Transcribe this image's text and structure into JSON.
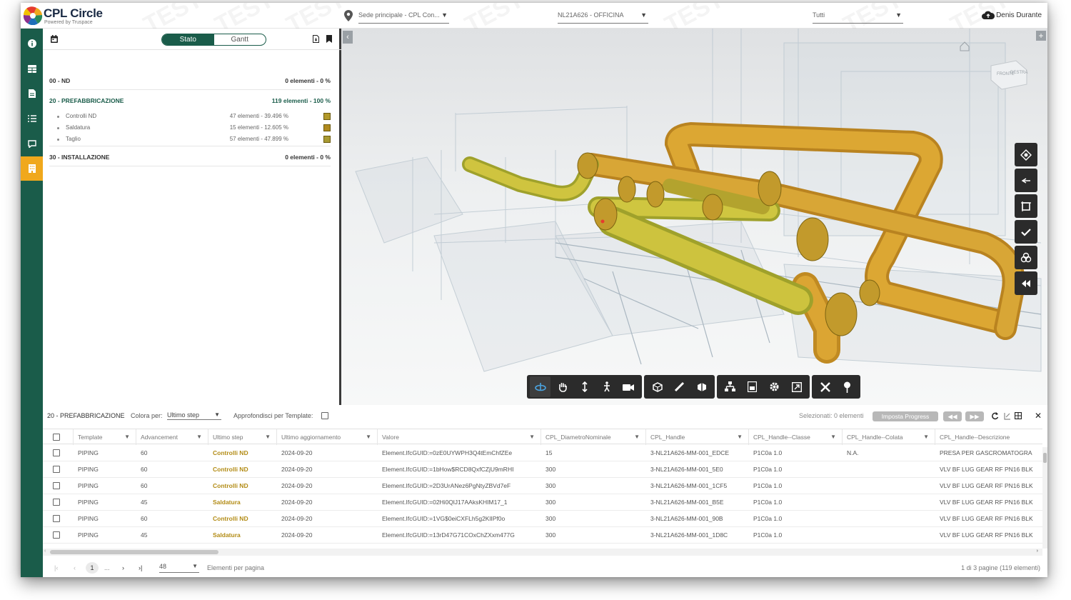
{
  "app": {
    "name": "CPL Circle",
    "tagline": "Powered by Truspace"
  },
  "header": {
    "site": "Sede principale - CPL Con...",
    "project": "NL21A626 - OFFICINA",
    "filter": "Tutti",
    "user": "Denis Durante",
    "watermark": "TEST"
  },
  "sidebar": {
    "items": [
      "info-icon",
      "grid-icon",
      "document-icon",
      "list-icon",
      "comment-icon",
      "building-icon"
    ],
    "active_index": 5
  },
  "left_panel": {
    "toggle": {
      "stato": "Stato",
      "gantt": "Gantt",
      "selected": "Stato"
    },
    "groups": [
      {
        "title": "00 - ND",
        "value": "0 elementi - 0 %"
      },
      {
        "title": "20 - PREFABBRICAZIONE",
        "value": "119 elementi - 100 %"
      },
      {
        "title": "30 - INSTALLAZIONE",
        "value": "0 elementi - 0 %"
      }
    ],
    "sub_items": [
      {
        "label": "Controlli ND",
        "value": "47 elementi - 39.496 %"
      },
      {
        "label": "Saldatura",
        "value": "15 elementi - 12.605 %"
      },
      {
        "label": "Taglio",
        "value": "57 elementi - 47.899 %"
      }
    ]
  },
  "viewer": {
    "view_cube_labels": [
      "FRONTE",
      "DESTRA"
    ]
  },
  "table_bar": {
    "group": "20 - PREFABBRICAZIONE",
    "color_by_label": "Colora per:",
    "color_by_value": "Ultimo step",
    "drill_label": "Approfondisci per Template:",
    "selected": "Selezionati: 0 elementi",
    "set_progress": "Imposta Progress"
  },
  "table": {
    "columns": [
      "Template",
      "Advancement",
      "Ultimo step",
      "Ultimo aggiornamento",
      "Valore",
      "CPL_DiametroNominale",
      "CPL_Handle",
      "CPL_Handle--Classe",
      "CPL_Handle--Colata",
      "CPL_Handle--Descrizione"
    ],
    "rows": [
      [
        "PIPING",
        "60",
        "Controlli ND",
        "2024-09-20",
        "Element.IfcGUID:=0zE0UYWPH3Q4tEmChfZEe",
        "15",
        "3-NL21A626-MM-001_EDCE",
        "P1C0a 1.0",
        "N.A.",
        "PRESA PER GASCROMATOGRA"
      ],
      [
        "PIPING",
        "60",
        "Controlli ND",
        "2024-09-20",
        "Element.IfcGUID:=1bHow$RCD8QxfCZjU9mRHI",
        "300",
        "3-NL21A626-MM-001_5E0",
        "P1C0a 1.0",
        "",
        "VLV BF LUG GEAR RF PN16 BLK"
      ],
      [
        "PIPING",
        "60",
        "Controlli ND",
        "2024-09-20",
        "Element.IfcGUID:=2D3UrANez6PgNtyZBVd7eF",
        "300",
        "3-NL21A626-MM-001_1CF5",
        "P1C0a 1.0",
        "",
        "VLV BF LUG GEAR RF PN16 BLK"
      ],
      [
        "PIPING",
        "45",
        "Saldatura",
        "2024-09-20",
        "Element.IfcGUID:=02Hi0QlJ17AAksKHIM17_1",
        "300",
        "3-NL21A626-MM-001_B5E",
        "P1C0a 1.0",
        "",
        "VLV BF LUG GEAR RF PN16 BLK"
      ],
      [
        "PIPING",
        "60",
        "Controlli ND",
        "2024-09-20",
        "Element.IfcGUID:=1VG$0eiCXFLh5g2KlIPf0o",
        "300",
        "3-NL21A626-MM-001_90B",
        "P1C0a 1.0",
        "",
        "VLV BF LUG GEAR RF PN16 BLK"
      ],
      [
        "PIPING",
        "45",
        "Saldatura",
        "2024-09-20",
        "Element.IfcGUID:=13rD47G71COxChZXxm477G",
        "300",
        "3-NL21A626-MM-001_1D8C",
        "P1C0a 1.0",
        "",
        "VLV BF LUG GEAR RF PN16 BLK"
      ]
    ]
  },
  "pager": {
    "first": "|‹",
    "prev": "‹",
    "page": "1",
    "ellipsis": "...",
    "next": "›",
    "last": "›|",
    "per_page": "48",
    "per_page_label": "Elementi per pagina",
    "summary": "1 di 3 pagine (119 elementi)"
  },
  "colors": {
    "brand_green": "#1a5c4a",
    "accent_orange": "#f0a81c",
    "pipe_orange": "#d9a531",
    "pipe_yellow": "#cfc43f",
    "step_text": "#b28b14"
  }
}
